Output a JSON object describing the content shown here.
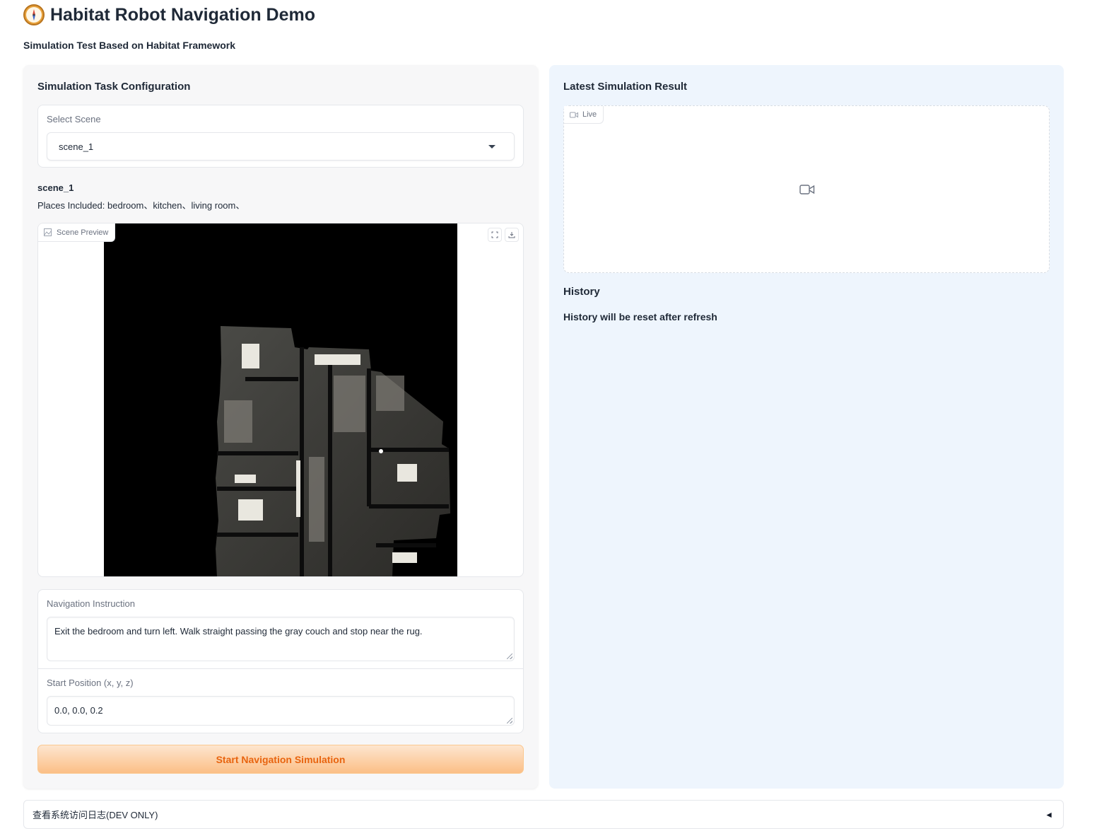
{
  "header": {
    "title": "Habitat Robot Navigation Demo",
    "subtitle": "Simulation Test Based on Habitat Framework",
    "logo_icon": "compass-icon"
  },
  "config": {
    "heading": "Simulation Task Configuration",
    "scene_select": {
      "label": "Select Scene",
      "value": "scene_1"
    },
    "scene_info": {
      "name": "scene_1",
      "places": "Places Included: bedroom、kitchen、living room、"
    },
    "preview": {
      "label": "Scene Preview",
      "fullscreen_icon": "fullscreen-icon",
      "download_icon": "download-icon"
    },
    "instruction": {
      "label": "Navigation Instruction",
      "value": "Exit the bedroom and turn left. Walk straight passing the gray couch and stop near the rug."
    },
    "start_position": {
      "label": "Start Position (x, y, z)",
      "value": "0.0, 0.0, 0.2"
    },
    "start_button": "Start Navigation Simulation"
  },
  "result": {
    "heading": "Latest Simulation Result",
    "video_label": "Live",
    "history_heading": "History",
    "history_note": "History will be reset after refresh"
  },
  "accordion": {
    "label": "查看系统访问日志(DEV ONLY)",
    "arrow": "◄"
  },
  "colors": {
    "accent": "#e8640f",
    "button_bg": "#fbbf86",
    "right_panel_bg": "#eef5fd",
    "left_panel_bg": "#f7f7f8"
  }
}
